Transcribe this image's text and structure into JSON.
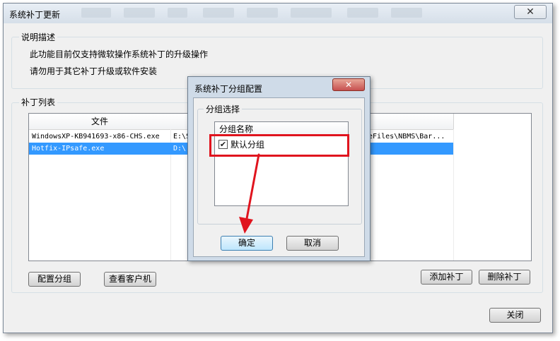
{
  "window": {
    "title": "系统补丁更新",
    "close_label": "✕"
  },
  "description": {
    "group_label": "说明描述",
    "line1": "此功能目前仅支持微软操作系统补丁的升级操作",
    "line2": "请勿用于其它补丁升级或软件安装"
  },
  "patches": {
    "group_label": "补丁列表",
    "columns": [
      "文件",
      ""
    ],
    "rows": [
      {
        "file": "WindowsXP-KB941693-x86-CHS.exe",
        "path": "E:\\S",
        "tail": "reFiles\\NBMS\\Bar..."
      },
      {
        "file": "Hotfix-IPsafe.exe",
        "path": "D:\\",
        "tail": ""
      }
    ],
    "configure_group_label": "配置分组",
    "view_clients_label": "查看客户机",
    "add_patch_label": "添加补丁",
    "delete_patch_label": "删除补丁"
  },
  "footer": {
    "close_label": "关闭"
  },
  "dialog": {
    "title": "系统补丁分组配置",
    "close_label": "✕",
    "group_box_label": "分组选择",
    "list_header": "分组名称",
    "item_label": "默认分组",
    "item_checked": true,
    "ok_label": "确定",
    "cancel_label": "取消"
  },
  "colors": {
    "selection": "#3399ff",
    "annotation": "#e0141e"
  }
}
